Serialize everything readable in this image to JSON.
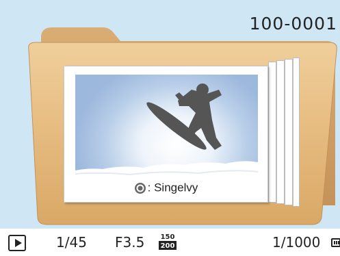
{
  "header": {
    "file_number": "100-0001"
  },
  "photo": {
    "caption": ": Singelvy",
    "mode_icon": "burst-mode-icon"
  },
  "status_bar": {
    "play_icon": "playback-icon",
    "frame_counter": "1/45",
    "aperture": "F3.5",
    "iso_top": "150",
    "iso_bottom": "200",
    "shutter_speed": "1/1000",
    "battery_icon": "battery-icon"
  },
  "colors": {
    "screen_background": "#cfe6f4",
    "folder": "#e6bf8a",
    "folder_dark": "#c99a5c",
    "snowboarder": "#555555"
  }
}
